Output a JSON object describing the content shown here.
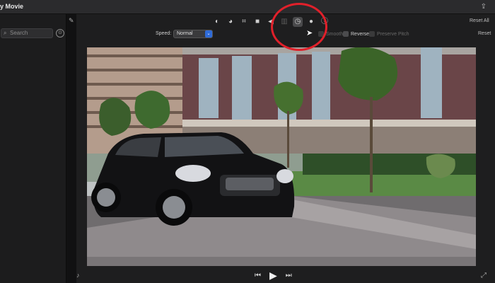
{
  "window": {
    "title": "y Movie"
  },
  "sidebar": {
    "search_placeholder": "Search"
  },
  "toolbar": {
    "icons": [
      "color-balance-icon",
      "color-correction-icon",
      "crop-icon",
      "stabilization-icon",
      "volume-icon",
      "noise-reduction-icon",
      "speed-icon",
      "clip-filter-icon",
      "info-icon"
    ],
    "reset_all": "Reset All"
  },
  "speed_controls": {
    "speed_label": "Speed:",
    "speed_value": "Normal",
    "smooth_label": "Smooth",
    "reverse_label": "Reverse",
    "preserve_pitch_label": "Preserve Pitch",
    "reset_label": "Reset"
  },
  "colors": {
    "accent": "#2f6bd8",
    "annotation": "#e0202a"
  }
}
